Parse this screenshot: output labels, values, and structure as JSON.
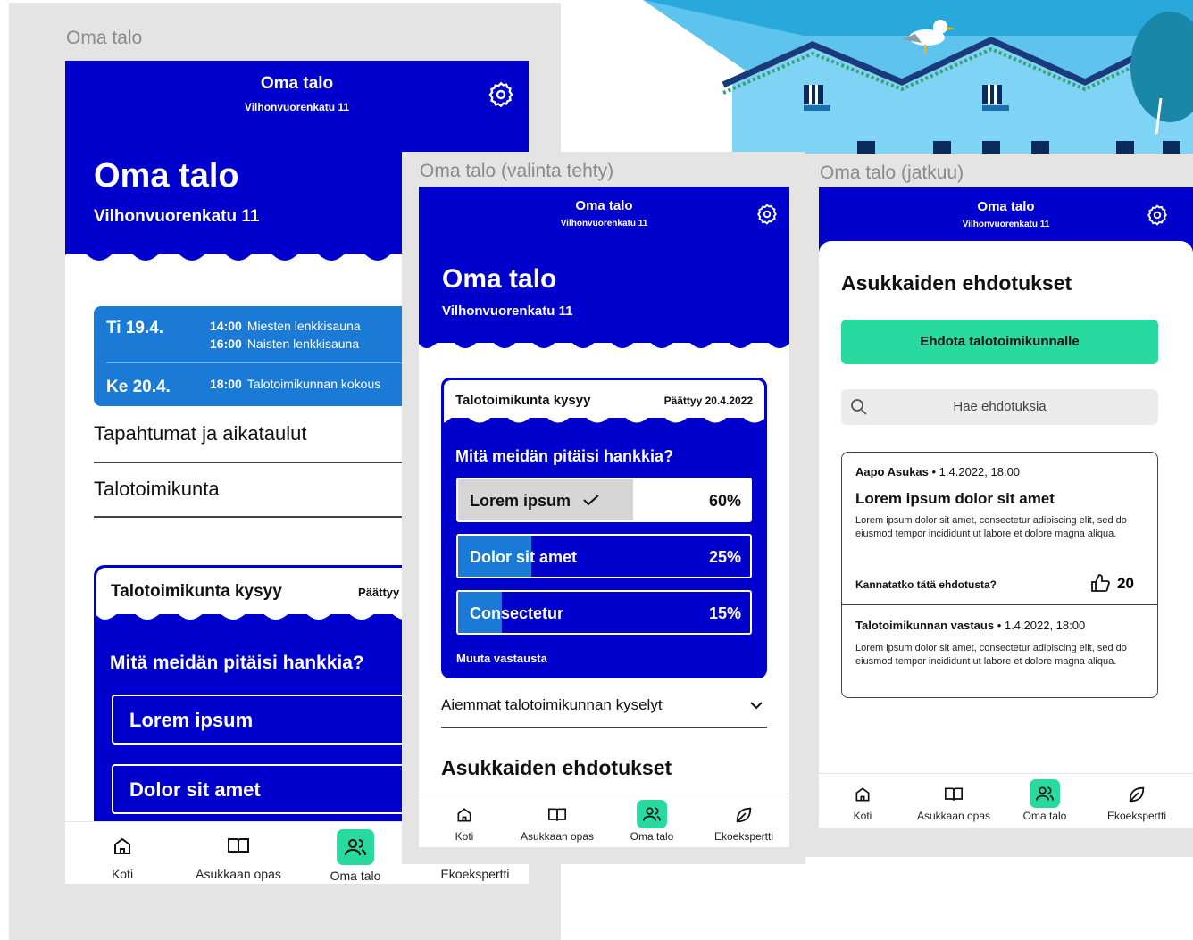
{
  "colors": {
    "brand_blue": "#0000cc",
    "event_blue": "#1a7ad6",
    "accent_green": "#28d9a0",
    "frame_gray": "#e4e4e4"
  },
  "header": {
    "title": "Oma talo",
    "address": "Vilhonvuorenkatu 11"
  },
  "nav": [
    {
      "label": "Koti",
      "icon": "home-icon"
    },
    {
      "label": "Asukkaan opas",
      "icon": "book-icon"
    },
    {
      "label": "Oma talo",
      "icon": "people-icon",
      "active": true
    },
    {
      "label": "Ekoekspertti",
      "icon": "leaf-icon"
    }
  ],
  "frame1": {
    "title": "Oma talo",
    "events": [
      {
        "day": "Ti 19.4.",
        "items": [
          {
            "time": "14:00",
            "name": "Miesten lenkkisauna"
          },
          {
            "time": "16:00",
            "name": "Naisten lenkkisauna"
          }
        ]
      },
      {
        "day": "Ke 20.4.",
        "items": [
          {
            "time": "18:00",
            "name": "Talotoimikunnan kokous"
          }
        ]
      }
    ],
    "links": [
      "Tapahtumat ja aikataulut",
      "Talotoimikunta"
    ],
    "poll": {
      "title": "Talotoimikunta kysyy",
      "status": "Päättyy",
      "question": "Mitä meidän pitäisi hankkia?",
      "options": [
        "Lorem ipsum",
        "Dolor sit amet"
      ]
    }
  },
  "frame2": {
    "title": "Oma talo (valinta tehty)",
    "poll": {
      "title": "Talotoimikunta kysyy",
      "status": "Päättyy 20.4.2022",
      "question": "Mitä meidän pitäisi hankkia?",
      "options": [
        {
          "label": "Lorem ipsum",
          "percent": "60%",
          "value": 0.6,
          "selected": true
        },
        {
          "label": "Dolor sit amet",
          "percent": "25%",
          "value": 0.25
        },
        {
          "label": "Consectetur",
          "percent": "15%",
          "value": 0.15
        }
      ],
      "change_answer": "Muuta vastausta"
    },
    "previous_polls": "Aiemmat talotoimikunnan kyselyt",
    "suggestions_heading": "Asukkaiden ehdotukset"
  },
  "frame3": {
    "title": "Oma talo (jatkuu)",
    "heading": "Asukkaiden ehdotukset",
    "suggest_button": "Ehdota talotoimikunnalle",
    "search_placeholder": "Hae ehdotuksia",
    "card": {
      "author": "Aapo Asukas",
      "date": "1.4.2022, 18:00",
      "title": "Lorem ipsum dolor sit amet",
      "body": "Lorem ipsum dolor sit amet, consectetur adipiscing elit, sed do eiusmod tempor incididunt ut labore et dolore magna aliqua.",
      "support_question": "Kannatatko tätä ehdotusta?",
      "likes": "20",
      "reply_author": "Talotoimikunnan vastaus",
      "reply_date": "1.4.2022, 18:00",
      "reply_body": "Lorem ipsum dolor sit amet, consectetur adipiscing elit, sed do eiusmod tempor incididunt ut labore et dolore magna aliqua."
    }
  }
}
